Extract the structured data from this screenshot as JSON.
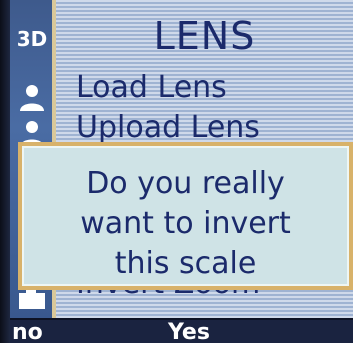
{
  "sidebar": {
    "mode_label": "3D",
    "icons": [
      "user-icon",
      "user-icon",
      "camera-icon"
    ]
  },
  "menu": {
    "title": "LENS",
    "items": [
      "Load Lens",
      "Upload Lens",
      "Invert Zoom"
    ]
  },
  "dialog": {
    "lines": [
      "Do you really",
      "want to invert",
      "this scale"
    ]
  },
  "softkeys": {
    "left": "no",
    "right": "Yes"
  },
  "colors": {
    "text": "#1b2a6b",
    "dialog_bg": "#cfe3e6",
    "dialog_border": "#d8b26a",
    "sidebar": "#4a6ca4"
  }
}
